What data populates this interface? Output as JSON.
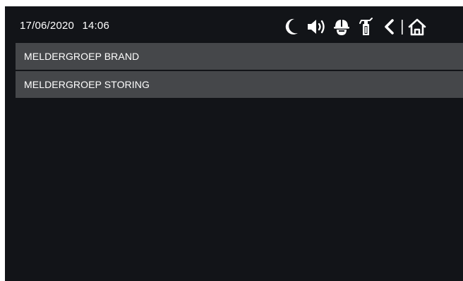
{
  "header": {
    "date": "17/06/2020",
    "time": "14:06",
    "icons": [
      "moon-icon",
      "speaker-icon",
      "firefighter-helmet-icon",
      "fire-extinguisher-icon",
      "back-icon",
      "home-icon"
    ]
  },
  "menu": {
    "items": [
      {
        "label": "MELDERGROEP BRAND"
      },
      {
        "label": "MELDERGROEP STORING"
      }
    ]
  },
  "colors": {
    "background": "#121418",
    "menu_item": "#45474a",
    "text": "#ffffff"
  }
}
